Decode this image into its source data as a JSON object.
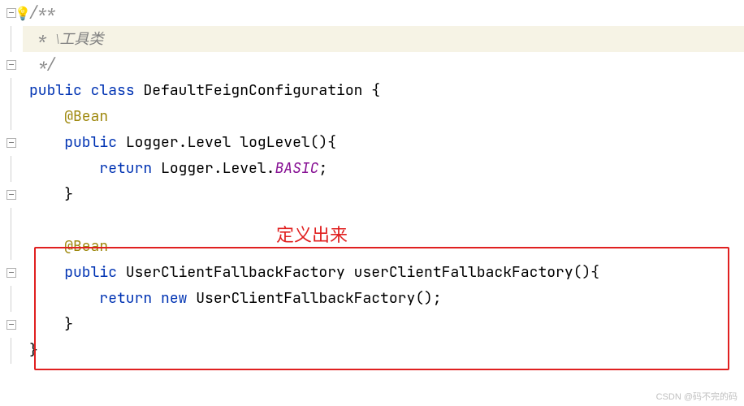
{
  "code": {
    "line1": "/**",
    "line2_prefix": " * ",
    "line2_text": "\\工具类",
    "line3": " */",
    "line4_kw1": "public",
    "line4_kw2": "class",
    "line4_type": "DefaultFeignConfiguration",
    "line4_brace": " {",
    "line5_anno": "@Bean",
    "line6_kw": "public",
    "line6_type1": "Logger",
    "line6_dot1": ".",
    "line6_type2": "Level",
    "line6_method": "logLevel",
    "line6_paren": "(){",
    "line7_kw": "return",
    "line7_type1": "Logger",
    "line7_dot1": ".",
    "line7_type2": "Level",
    "line7_dot2": ".",
    "line7_field": "BASIC",
    "line7_semi": ";",
    "line8": "}",
    "line10_anno": "@Bean",
    "line11_kw": "public",
    "line11_type": "UserClientFallbackFactory",
    "line11_method": "userClientFallbackFactory",
    "line11_paren": "(){",
    "line12_kw1": "return",
    "line12_kw2": "new",
    "line12_type": "UserClientFallbackFactory",
    "line12_paren": "();",
    "line13": "}",
    "line14": "}"
  },
  "annotation": {
    "label": "定义出来"
  },
  "watermark": "CSDN @码不完的码"
}
